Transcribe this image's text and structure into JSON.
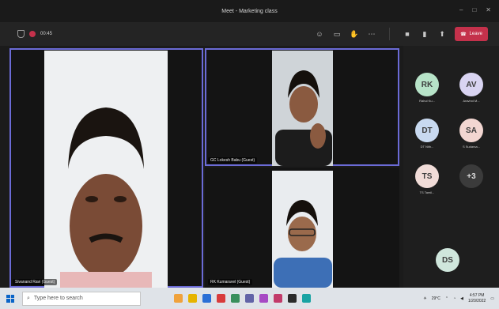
{
  "window": {
    "title": "Meet - Marketing class"
  },
  "toolbar": {
    "timer": "00:45",
    "leave_label": "Leave"
  },
  "tiles": [
    {
      "name": "Sivanand Ravi (Guest)"
    },
    {
      "name": "GC Lokesh Babu (Guest)"
    },
    {
      "name": "RK Kumaravel (Guest)"
    }
  ],
  "roster": [
    {
      "initials": "RK",
      "label": "Rahul Ku...",
      "color": "#b7e3c8"
    },
    {
      "initials": "AV",
      "label": "Aravind M...",
      "color": "#d9d4f2"
    },
    {
      "initials": "DT",
      "label": "DT Nith...",
      "color": "#c8d9f0"
    },
    {
      "initials": "SA",
      "label": "S Sudarsa...",
      "color": "#f2d6d1"
    },
    {
      "initials": "TS",
      "label": "TS Tamil...",
      "color": "#f1dcd8"
    },
    {
      "initials": "+3",
      "label": "",
      "color": "#3b3b3b"
    },
    {
      "initials": "DS",
      "label": "",
      "color": "#cfe6dc"
    }
  ],
  "taskbar": {
    "search_placeholder": "Type here to search",
    "weather": "29°C",
    "time": "4:57 PM",
    "date": "1/20/2022"
  },
  "colors": {
    "accent": "#6b6bd6",
    "leave": "#c4314b"
  }
}
